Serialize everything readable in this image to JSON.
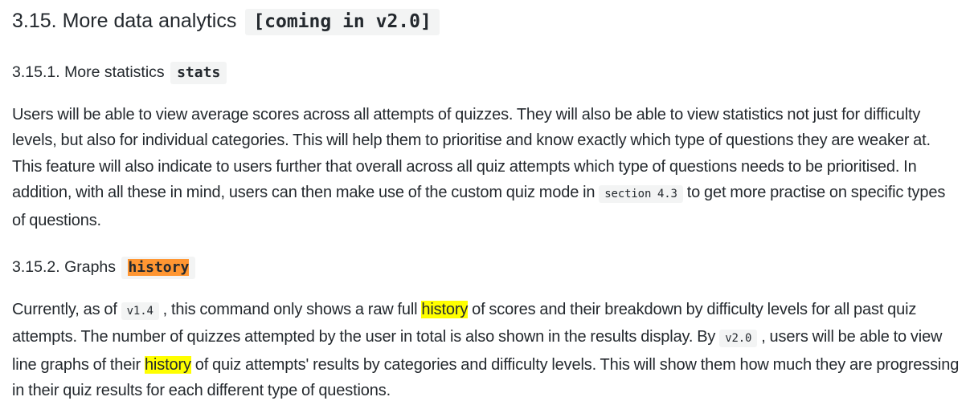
{
  "section": {
    "number": "3.15.",
    "title": "More data analytics",
    "tag": "[coming in v2.0]"
  },
  "subsection1": {
    "number": "3.15.1.",
    "title": "More statistics",
    "command": "stats",
    "paragraph": {
      "text_1": "Users will be able to view average scores across all attempts of quizzes. They will also be able to view statistics not just for difficulty levels, but also for individual categories. This will help them to prioritise and know exactly which type of questions they are weaker at. This feature will also indicate to users further that overall across all quiz attempts which type of questions needs to be prioritised. In addition, with all these in mind, users can then make use of the custom quiz mode in ",
      "code_1": "section 4.3",
      "text_2": " to get more practise on specific types of questions."
    }
  },
  "subsection2": {
    "number": "3.15.2.",
    "title": "Graphs",
    "command": "history",
    "paragraph": {
      "text_1": "Currently, as of ",
      "code_1": "v1.4",
      "text_2": " , this command only shows a raw full ",
      "highlight_1": "history",
      "text_3": " of scores and their breakdown by difficulty levels for all past quiz attempts. The number of quizzes attempted by the user in total is also shown in the results display. By ",
      "code_2": "v2.0",
      "text_4": " , users will be able to view line graphs of their ",
      "highlight_2": "history",
      "text_5": " of quiz attempts' results by categories and difficulty levels. This will show them how much they are progressing in their quiz results for each different type of questions."
    }
  },
  "colors": {
    "text": "#24292e",
    "code_background": "#f3f4f4",
    "search_highlight": "#ffff00",
    "current_match_highlight": "#ff9632"
  }
}
